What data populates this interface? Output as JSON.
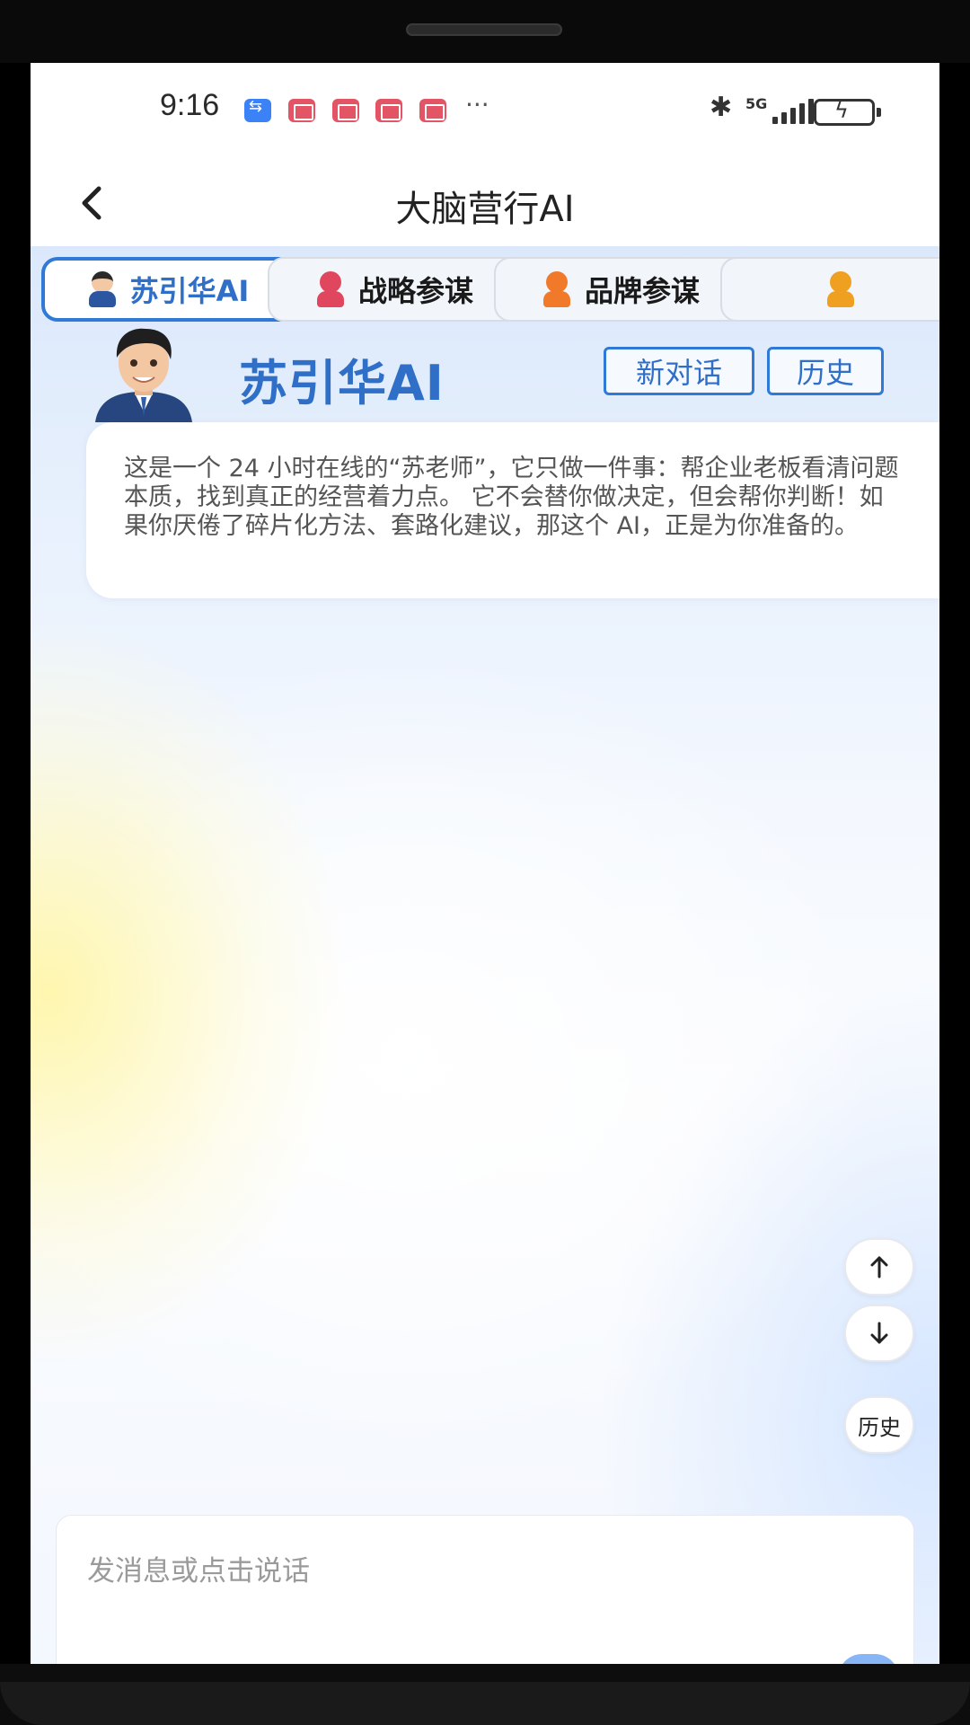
{
  "status_bar": {
    "time": "9:16",
    "network": "5G",
    "more_indicator": "···",
    "icons": [
      "usb-icon",
      "book-icon",
      "book-icon",
      "book-icon",
      "book-icon",
      "bluetooth-icon",
      "signal-icon",
      "battery-charging-icon"
    ]
  },
  "header": {
    "title": "大脑营行AI",
    "back_icon": "chevron-left-icon"
  },
  "tabs": [
    {
      "label": "苏引华AI",
      "active": true,
      "color": "#2f6fc7"
    },
    {
      "label": "战略参谋",
      "active": false,
      "color": "#e0475e"
    },
    {
      "label": "品牌参谋",
      "active": false,
      "color": "#f07a2a"
    },
    {
      "label": "",
      "active": false,
      "color": "#f0a020"
    }
  ],
  "profile": {
    "name": "苏引华AI",
    "new_chat": "新对话",
    "history": "历史"
  },
  "intro": {
    "text": "这是一个 24 小时在线的“苏老师”，它只做一件事：帮企业老板看清问题本质，找到真正的经营着力点。 它不会替你做决定，但会帮你判断！如果你厌倦了碎片化方法、套路化建议，那这个 AI，正是为你准备的。"
  },
  "float_buttons": {
    "scroll_up": "arrow-up-icon",
    "scroll_down": "arrow-down-icon",
    "history": "历史"
  },
  "composer": {
    "placeholder": "发消息或点击说话",
    "icons": [
      "voice-icon",
      "folder-icon",
      "camera-icon",
      "send-arrow-icon"
    ]
  },
  "colors": {
    "accent": "#2f7ad6",
    "send_button": "#88b5f5"
  }
}
